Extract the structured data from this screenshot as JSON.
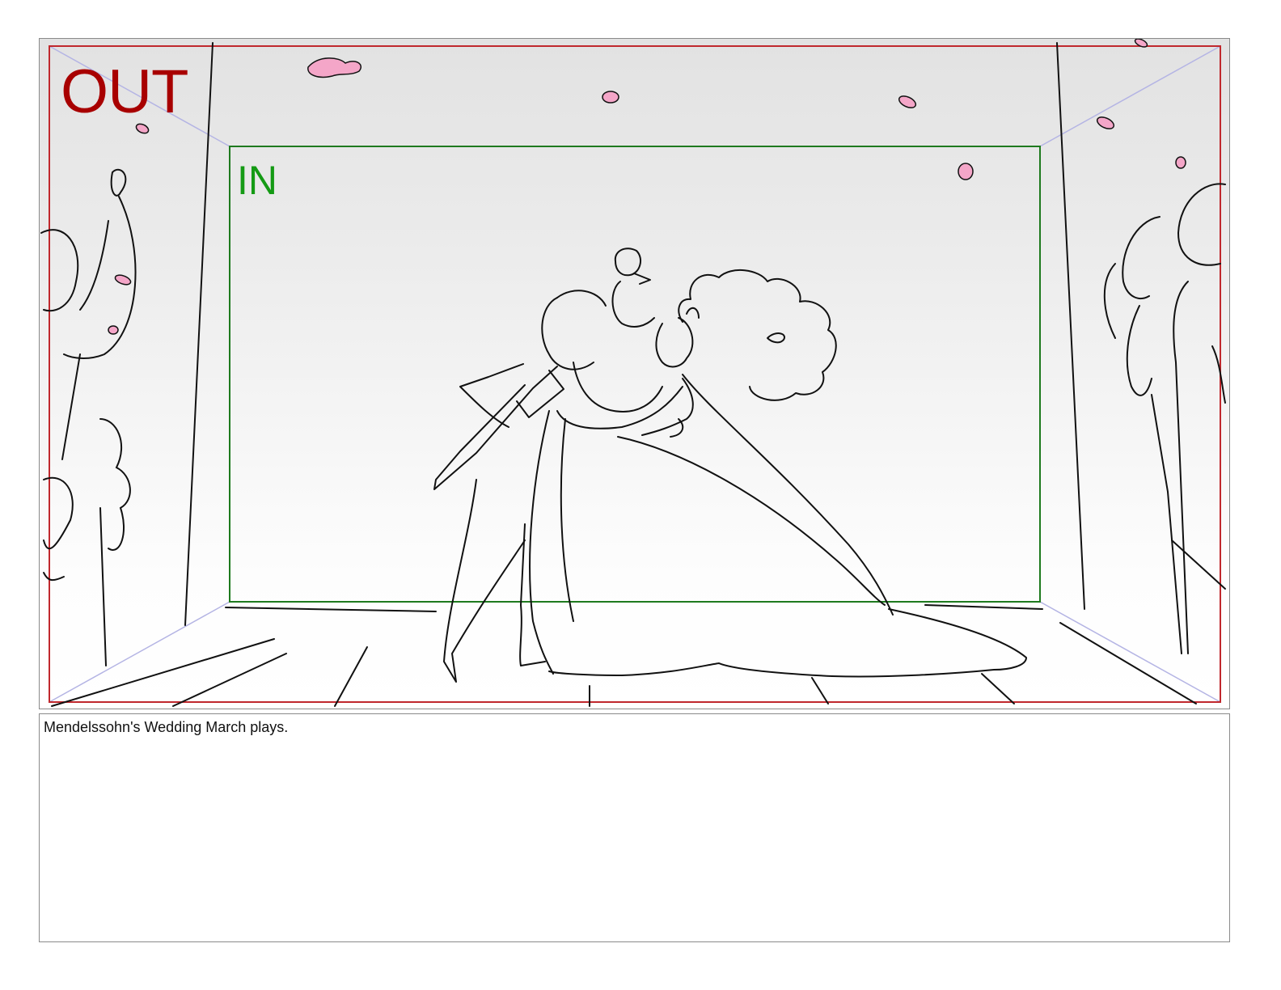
{
  "panel": {
    "out_label": "OUT",
    "in_label": "IN",
    "colors": {
      "out_frame": "#c0282d",
      "in_frame": "#1e7a1e",
      "out_text": "#a80000",
      "in_text": "#149a14",
      "perspective_lines": "#aaaadd",
      "petals": "#f4a6c8",
      "line_art": "#111111"
    },
    "drawing": "storyboard-sketch-couple-dancing"
  },
  "caption": {
    "text": "Mendelssohn's Wedding March plays."
  }
}
